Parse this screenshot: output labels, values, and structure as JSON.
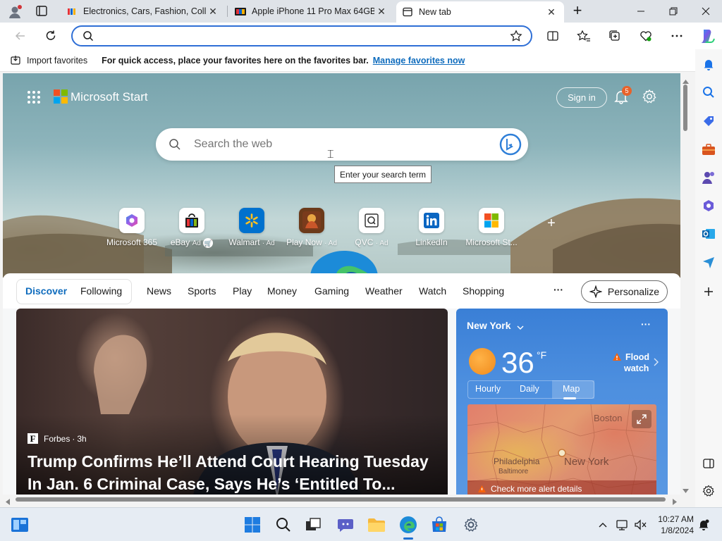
{
  "browser": {
    "tabs": [
      {
        "title": "Electronics, Cars, Fashion, Collect",
        "favicon": "ebay-icon",
        "active": false
      },
      {
        "title": "Apple iPhone 11 Pro Max 64GB |",
        "favicon": "ebay-icon",
        "active": false
      },
      {
        "title": "New tab",
        "favicon": "newtab-icon",
        "active": true
      }
    ],
    "new_tab_label": "+",
    "close_glyph": "✕"
  },
  "address": {
    "value": "",
    "placeholder": ""
  },
  "favorites_bar": {
    "import_label": "Import favorites",
    "message": "For quick access, place your favorites here on the favorites bar.",
    "manage_link": "Manage favorites now"
  },
  "start": {
    "brand": "Microsoft Start",
    "sign_in": "Sign in",
    "notification_count": "5",
    "search_placeholder": "Search the web",
    "tooltip": "Enter your search term",
    "quick_links": [
      {
        "label": "Microsoft 365",
        "ad": ""
      },
      {
        "label": "eBay",
        "ad": "Ad"
      },
      {
        "label": "Walmart",
        "ad": "· Ad"
      },
      {
        "label": "Play Now",
        "ad": "· Ad"
      },
      {
        "label": "QVC",
        "ad": "· Ad"
      },
      {
        "label": "LinkedIn",
        "ad": ""
      },
      {
        "label": "Microsoft St...",
        "ad": ""
      }
    ],
    "add_link": "+"
  },
  "nav": {
    "items": [
      "Discover",
      "Following",
      "News",
      "Sports",
      "Play",
      "Money",
      "Gaming",
      "Weather",
      "Watch",
      "Shopping"
    ],
    "more": "···",
    "personalize": "Personalize"
  },
  "feature": {
    "source": "Forbes",
    "source_logo": "F",
    "age": "3h",
    "headline": "Trump Confirms He’ll Attend Court Hearing Tuesday In Jan. 6 Criminal Case, Says He’s ‘Entitled To..."
  },
  "weather": {
    "city": "New York",
    "temp": "36",
    "unit": "°F",
    "alert_line1": "Flood",
    "alert_line2": "watch",
    "tabs": [
      "Hourly",
      "Daily",
      "Map"
    ],
    "active_tab": "Map",
    "map_labels": {
      "boston": "Boston",
      "philadelphia": "Philadelphia",
      "baltimore": "Baltimore",
      "newyork": "New York"
    },
    "alert_details": "Check more alert details",
    "menu": "···"
  },
  "taskbar": {
    "time": "10:27 AM",
    "date": "1/8/2024"
  },
  "colors": {
    "accent": "#0f6cbd",
    "address_border": "#2f6fd6",
    "weather_bg": "#4d8fdf",
    "notification_badge": "#e8622a"
  }
}
